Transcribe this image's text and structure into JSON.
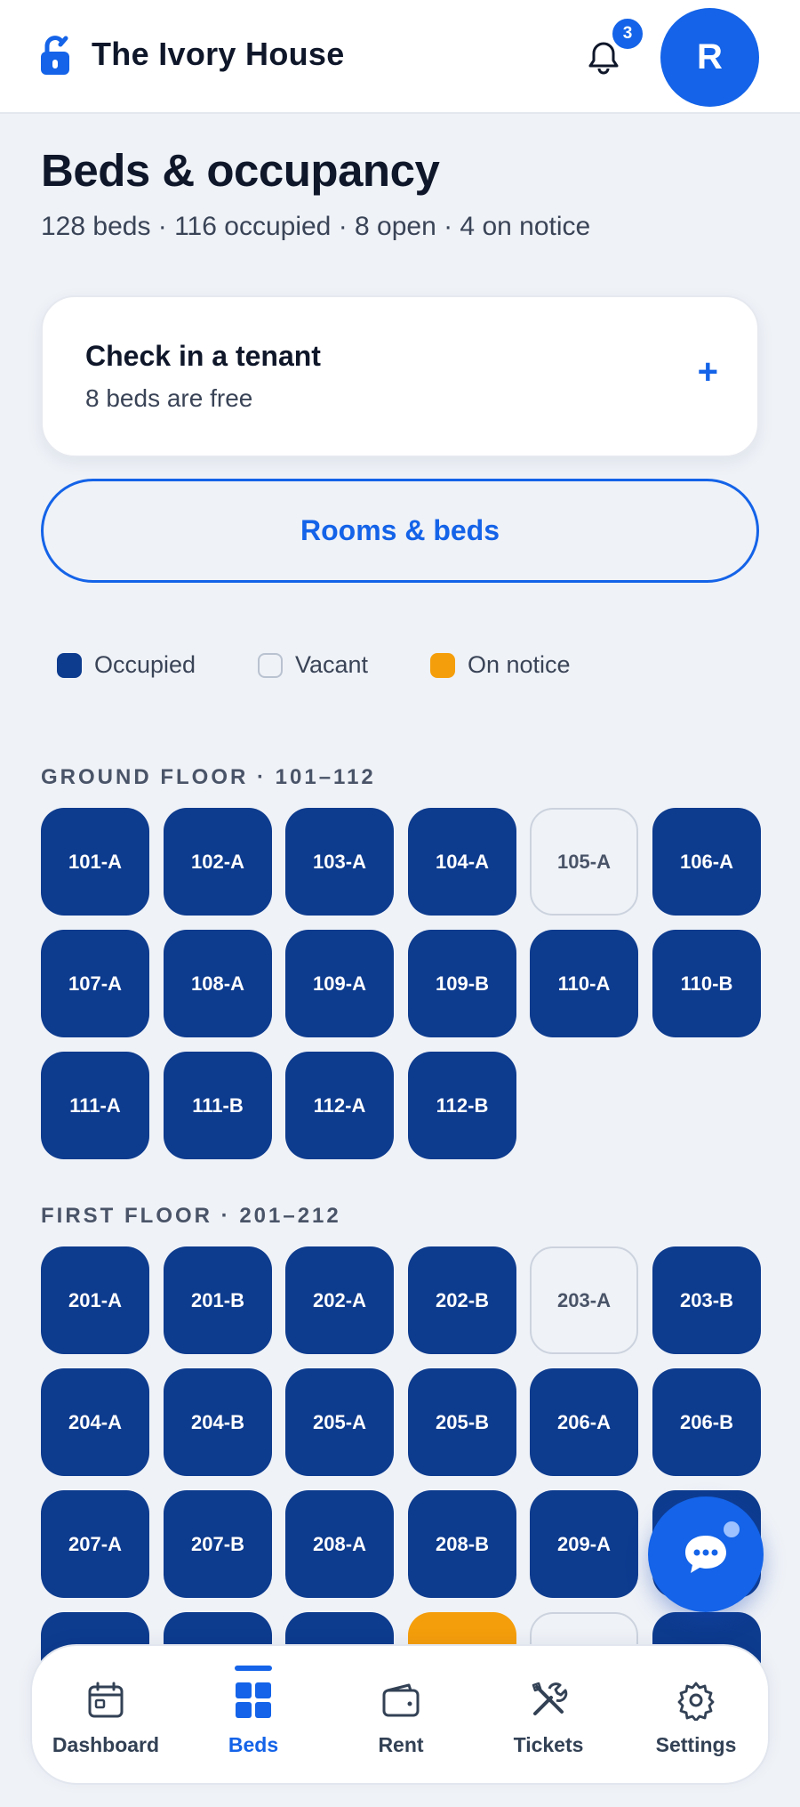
{
  "app": {
    "name": "The Ivory House",
    "notification_count": "3",
    "avatar_initial": "R"
  },
  "page": {
    "title": "Beds & occupancy",
    "subtitle": "128 beds · 116 occupied · 8 open · 4 on notice"
  },
  "checkin": {
    "title": "Check in a tenant",
    "subtitle": "8 beds are free",
    "action_symbol": "+"
  },
  "rooms_button": {
    "label": "Rooms & beds"
  },
  "legend": [
    {
      "label": "Occupied",
      "status": "occupied"
    },
    {
      "label": "Vacant",
      "status": "vacant"
    },
    {
      "label": "On notice",
      "status": "notice"
    }
  ],
  "colors": {
    "accent": "#1463e8",
    "occupied": "#0d3b8e",
    "vacant": "#eff2f7",
    "notice": "#f59e0b"
  },
  "floors": [
    {
      "label": "GROUND FLOOR · 101–112",
      "beds": [
        {
          "id": "101-A",
          "status": "occupied"
        },
        {
          "id": "102-A",
          "status": "occupied"
        },
        {
          "id": "103-A",
          "status": "occupied"
        },
        {
          "id": "104-A",
          "status": "occupied"
        },
        {
          "id": "105-A",
          "status": "vacant"
        },
        {
          "id": "106-A",
          "status": "occupied"
        },
        {
          "id": "107-A",
          "status": "occupied"
        },
        {
          "id": "108-A",
          "status": "occupied"
        },
        {
          "id": "109-A",
          "status": "occupied"
        },
        {
          "id": "109-B",
          "status": "occupied"
        },
        {
          "id": "110-A",
          "status": "occupied"
        },
        {
          "id": "110-B",
          "status": "occupied"
        },
        {
          "id": "111-A",
          "status": "occupied"
        },
        {
          "id": "111-B",
          "status": "occupied"
        },
        {
          "id": "112-A",
          "status": "occupied"
        },
        {
          "id": "112-B",
          "status": "occupied"
        }
      ]
    },
    {
      "label": "FIRST FLOOR · 201–212",
      "beds": [
        {
          "id": "201-A",
          "status": "occupied"
        },
        {
          "id": "201-B",
          "status": "occupied"
        },
        {
          "id": "202-A",
          "status": "occupied"
        },
        {
          "id": "202-B",
          "status": "occupied"
        },
        {
          "id": "203-A",
          "status": "vacant"
        },
        {
          "id": "203-B",
          "status": "occupied"
        },
        {
          "id": "204-A",
          "status": "occupied"
        },
        {
          "id": "204-B",
          "status": "occupied"
        },
        {
          "id": "205-A",
          "status": "occupied"
        },
        {
          "id": "205-B",
          "status": "occupied"
        },
        {
          "id": "206-A",
          "status": "occupied"
        },
        {
          "id": "206-B",
          "status": "occupied"
        },
        {
          "id": "207-A",
          "status": "occupied"
        },
        {
          "id": "207-B",
          "status": "occupied"
        },
        {
          "id": "208-A",
          "status": "occupied"
        },
        {
          "id": "208-B",
          "status": "occupied"
        },
        {
          "id": "209-A",
          "status": "occupied"
        },
        {
          "id": "",
          "status": "occupied"
        },
        {
          "id": "",
          "status": "occupied"
        },
        {
          "id": "",
          "status": "occupied"
        },
        {
          "id": "",
          "status": "occupied"
        },
        {
          "id": "",
          "status": "notice"
        },
        {
          "id": "",
          "status": "vacant"
        },
        {
          "id": "",
          "status": "occupied"
        }
      ]
    }
  ],
  "nav": {
    "items": [
      {
        "label": "Dashboard",
        "icon": "calendar-icon"
      },
      {
        "label": "Beds",
        "icon": "grid-icon",
        "active": true
      },
      {
        "label": "Rent",
        "icon": "wallet-icon"
      },
      {
        "label": "Tickets",
        "icon": "tools-icon"
      },
      {
        "label": "Settings",
        "icon": "gear-icon"
      }
    ]
  }
}
